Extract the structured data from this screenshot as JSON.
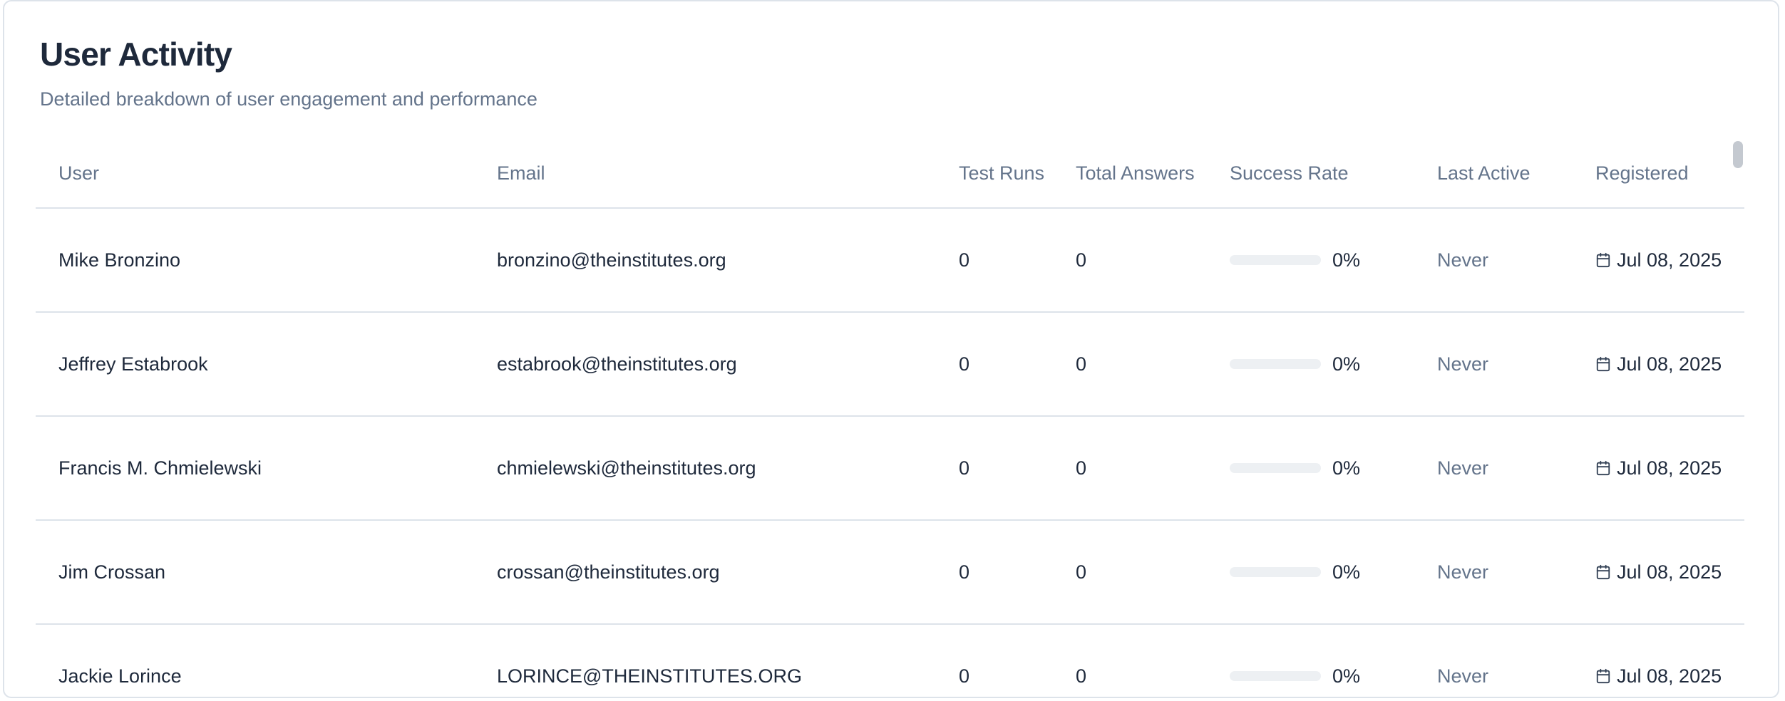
{
  "card": {
    "title": "User Activity",
    "subtitle": "Detailed breakdown of user engagement and performance"
  },
  "table": {
    "columns": {
      "user": "User",
      "email": "Email",
      "test_runs": "Test Runs",
      "total_answers": "Total Answers",
      "success_rate": "Success Rate",
      "last_active": "Last Active",
      "registered": "Registered"
    },
    "rows": [
      {
        "user": "Mike Bronzino",
        "email": "bronzino@theinstitutes.org",
        "test_runs": "0",
        "total_answers": "0",
        "success_rate": "0%",
        "success_fraction": 0,
        "last_active": "Never",
        "registered": "Jul 08, 2025"
      },
      {
        "user": "Jeffrey Estabrook",
        "email": "estabrook@theinstitutes.org",
        "test_runs": "0",
        "total_answers": "0",
        "success_rate": "0%",
        "success_fraction": 0,
        "last_active": "Never",
        "registered": "Jul 08, 2025"
      },
      {
        "user": "Francis M. Chmielewski",
        "email": "chmielewski@theinstitutes.org",
        "test_runs": "0",
        "total_answers": "0",
        "success_rate": "0%",
        "success_fraction": 0,
        "last_active": "Never",
        "registered": "Jul 08, 2025"
      },
      {
        "user": "Jim Crossan",
        "email": "crossan@theinstitutes.org",
        "test_runs": "0",
        "total_answers": "0",
        "success_rate": "0%",
        "success_fraction": 0,
        "last_active": "Never",
        "registered": "Jul 08, 2025"
      },
      {
        "user": "Jackie Lorince",
        "email": "LORINCE@THEINSTITUTES.ORG",
        "test_runs": "0",
        "total_answers": "0",
        "success_rate": "0%",
        "success_fraction": 0,
        "last_active": "Never",
        "registered": "Jul 08, 2025"
      }
    ]
  },
  "icons": {
    "registered_icon": "calendar-icon"
  },
  "colors": {
    "title": "#1e293b",
    "muted": "#64748b",
    "border": "#dde3ea",
    "bar_track": "#edf0f3"
  }
}
